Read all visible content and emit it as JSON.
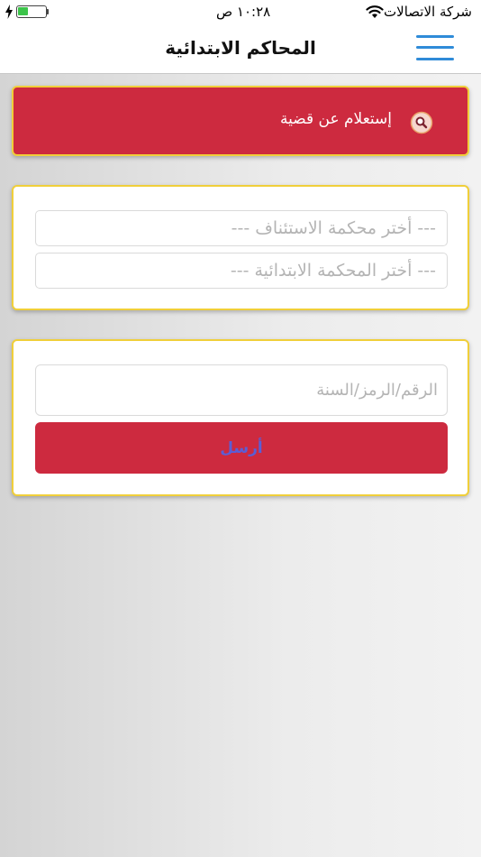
{
  "status_bar": {
    "carrier": "شركة الاتصالات",
    "time": "١٠:٢٨ ص",
    "icons": [
      "wifi-icon",
      "battery-icon",
      "charging-icon"
    ]
  },
  "nav": {
    "title": "المحاكم الابتدائية",
    "menu_icon": "hamburger-menu-icon"
  },
  "inquiry": {
    "label": "إستعلام عن قضية",
    "icon": "search-icon"
  },
  "court_selection": {
    "appeal_court_placeholder": "--- أختر محكمة الاستئناف ---",
    "primary_court_placeholder": "--- أختر المحكمة الابتدائية ---"
  },
  "case_form": {
    "case_number_placeholder": "الرقم/الرمز/السنة",
    "submit_label": "أرسل"
  },
  "colors": {
    "accent_red": "#cd2a3f",
    "card_border_yellow": "#f0cf3a",
    "menu_blue": "#2f8bd8",
    "submit_text_blue": "#5a5ed6"
  }
}
